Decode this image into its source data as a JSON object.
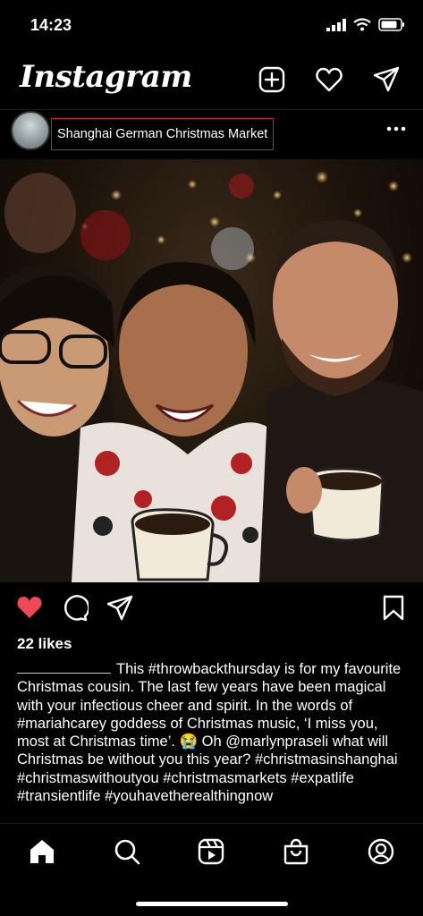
{
  "status": {
    "time": "14:23"
  },
  "app": {
    "logo": "Instagram"
  },
  "post": {
    "location": "Shanghai German Christmas Market",
    "likes": "22 likes",
    "caption": "This #throwbackthursday is for my favourite Christmas cousin. The last few years have been magical with your infectious cheer and spirit. In the words of #mariahcarey goddess of Christmas music, ‘I miss you, most at Christmas time’. 😭 Oh @marlynpraseli what will Christmas be without you this year?  #christmasinshanghai #christmaswithoutyou #christmasmarkets #expatlife #transientlife #youhavetherealthingnow",
    "liked": true
  },
  "icons": {
    "top": [
      "new-post-icon",
      "activity-heart-icon",
      "direct-message-icon"
    ],
    "actions": [
      "like-heart-icon",
      "comment-icon",
      "share-icon",
      "save-bookmark-icon"
    ],
    "nav": [
      "home-icon",
      "search-icon",
      "reels-icon",
      "shop-icon",
      "profile-icon"
    ]
  },
  "colors": {
    "like": "#ed4956",
    "location_border": "#c62828"
  }
}
